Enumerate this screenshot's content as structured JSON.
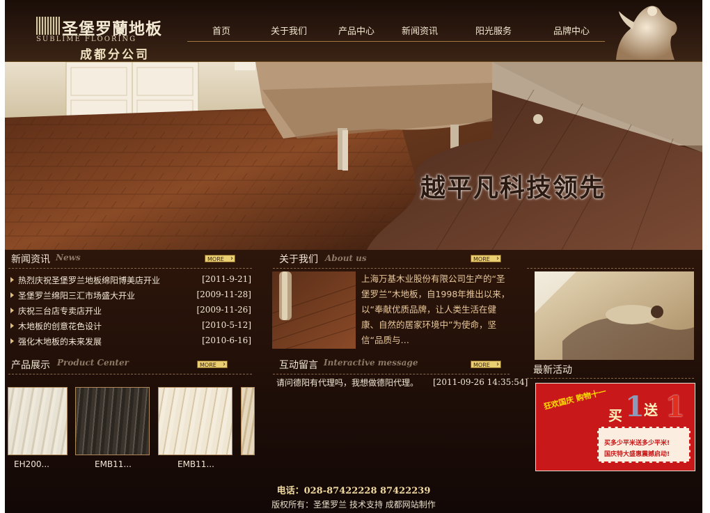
{
  "header": {
    "logo_cn": "圣堡罗蘭地板",
    "logo_en": "SUBLIME FLOORING",
    "logo_branch": "成都分公司",
    "nav": [
      "首页",
      "关于我们",
      "产品中心",
      "新闻资讯",
      "阳光服务",
      "品牌中心"
    ]
  },
  "banner": {
    "slogan": "越平凡科技领先"
  },
  "news": {
    "title": "新闻资讯",
    "title_en": "News",
    "more": "MORE",
    "items": [
      {
        "title": "热烈庆祝圣堡罗兰地板绵阳博美店开业",
        "date": "[2011-9-21]"
      },
      {
        "title": "圣堡罗兰绵阳三汇市场盛大开业",
        "date": "[2009-11-28]"
      },
      {
        "title": "庆祝三台店专卖店开业",
        "date": "[2009-11-26]"
      },
      {
        "title": "木地板的创意花色设计",
        "date": "[2010-5-12]"
      },
      {
        "title": "强化木地板的未来发展",
        "date": "[2010-6-16]"
      }
    ]
  },
  "about": {
    "title": "关于我们",
    "title_en": "About us",
    "more": "MORE",
    "text": "上海万基木业股份有限公司生产的“圣堡罗兰”木地板，自1998年推出以来，以“奉献优质品牌，让人类生活在健康、自然的居家环境中”为使命，坚信“品质与…"
  },
  "products": {
    "title": "产品展示",
    "title_en": "Product Center",
    "more": "MORE",
    "items": [
      {
        "label": "EH200..."
      },
      {
        "label": "EMB11..."
      },
      {
        "label": "EMB11..."
      },
      {
        "label": ""
      }
    ]
  },
  "messages": {
    "title": "互动留言",
    "title_en": "Interactive message",
    "more": "MORE",
    "items": [
      {
        "text": "请问德阳有代理吗，我想做德阳代理。",
        "time": "[2011-09-26 14:35:54]"
      }
    ]
  },
  "activities": {
    "title": "最新活动",
    "promo": {
      "headline": "狂欢国庆 购物十一",
      "buy": "买",
      "one_a": "1",
      "give": "送",
      "one_b": "1",
      "line1": "买多少平米送多少平米!",
      "line2": "国庆特大盛惠震撼启动!"
    }
  },
  "footer": {
    "phone": "电话：028-87422228  87422239",
    "copyright": "版权所有：圣堡罗兰  技术支持 成都网站制作"
  },
  "colors": {
    "accent": "#e9cf72",
    "bg_dark": "#2a140a",
    "text": "#f2e8d6",
    "about_text": "#e8c89a"
  }
}
